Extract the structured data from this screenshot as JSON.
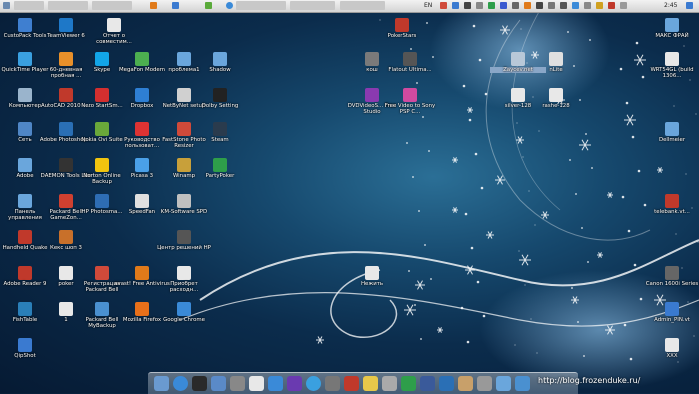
{
  "menubar": {
    "language": "EN",
    "time": "2:45"
  },
  "icons": [
    {
      "label": "CustoPack Tools",
      "icon": "custopack-icon",
      "color": "#3f7fd0"
    },
    {
      "label": "TeamViewer 6",
      "icon": "teamviewer-icon",
      "color": "#1e78c8"
    },
    {
      "label": "Отчет о совместим...",
      "icon": "document-icon",
      "color": "#e8e8e8"
    },
    {
      "label": "QuickTime Player",
      "icon": "quicktime-icon",
      "color": "#3aa0e0"
    },
    {
      "label": "60-дневная пробная ...",
      "icon": "office-icon",
      "color": "#e8902a"
    },
    {
      "label": "Skype",
      "icon": "skype-icon",
      "color": "#12a5e8"
    },
    {
      "label": "MegaFon Modem",
      "icon": "megafon-icon",
      "color": "#4caf50"
    },
    {
      "label": "проблема1",
      "icon": "folder-icon",
      "color": "#6aa6dc"
    },
    {
      "label": "Shadow",
      "icon": "folder-icon",
      "color": "#6aa6dc"
    },
    {
      "label": "Компьютер",
      "icon": "computer-icon",
      "color": "#9ab4cc"
    },
    {
      "label": "AutoCAD 2010 - ...",
      "icon": "autocad-icon",
      "color": "#c0392b"
    },
    {
      "label": "Nero StartSm...",
      "icon": "nero-icon",
      "color": "#d32f2f"
    },
    {
      "label": "Dropbox",
      "icon": "dropbox-icon",
      "color": "#2e7fd4"
    },
    {
      "label": "NetByNet setup",
      "icon": "netbynet-icon",
      "color": "#d0d0d0"
    },
    {
      "label": "Dolby Setting",
      "icon": "dolby-icon",
      "color": "#222222"
    },
    {
      "label": "Сеть",
      "icon": "network-icon",
      "color": "#4f86c6"
    },
    {
      "label": "Adobe Photoshop...",
      "icon": "photoshop-icon",
      "color": "#2a6fb5"
    },
    {
      "label": "Nokia Ovi Suite",
      "icon": "nokia-ovi-icon",
      "color": "#6aa83a"
    },
    {
      "label": "Руководство пользоват...",
      "icon": "help-icon",
      "color": "#d33"
    },
    {
      "label": "FastStone Photo Resizer",
      "icon": "faststone-icon",
      "color": "#d04a3a"
    },
    {
      "label": "Steam",
      "icon": "steam-icon",
      "color": "#2a3b4d"
    },
    {
      "label": "Adobe",
      "icon": "folder-icon",
      "color": "#6aa6dc"
    },
    {
      "label": "DAEMON Tools Lite",
      "icon": "daemon-tools-icon",
      "color": "#333"
    },
    {
      "label": "Norton Online Backup",
      "icon": "norton-icon",
      "color": "#f1c40f"
    },
    {
      "label": "Picasa 3",
      "icon": "picasa-icon",
      "color": "#4aa0e8"
    },
    {
      "label": "Winamp",
      "icon": "winamp-icon",
      "color": "#c8a03a"
    },
    {
      "label": "PartyPoker",
      "icon": "partypoker-icon",
      "color": "#2e9e4a"
    },
    {
      "label": "Панель управления",
      "icon": "control-panel-icon",
      "color": "#6aa6dc"
    },
    {
      "label": "Packard Bell GameZon...",
      "icon": "gamezone-icon",
      "color": "#d04030"
    },
    {
      "label": "HP Photosma...",
      "icon": "hp-icon",
      "color": "#2e6db4"
    },
    {
      "label": "SpeedFan",
      "icon": "speedfan-icon",
      "color": "#e0e0e0"
    },
    {
      "label": "KM-Software SPD",
      "icon": "km-software-icon",
      "color": "#c0c0c0"
    },
    {
      "label": "Handheld Quake",
      "icon": "quake-icon",
      "color": "#c0392b"
    },
    {
      "label": "Кекс шоп 3",
      "icon": "game-icon",
      "color": "#c8702a"
    },
    {
      "label": "Центр решений HP",
      "icon": "hp-center-icon",
      "color": "#555"
    },
    {
      "label": "Adobe Reader 9",
      "icon": "adobe-reader-icon",
      "color": "#c0392b"
    },
    {
      "label": "poker",
      "icon": "document-icon",
      "color": "#e8e8e8"
    },
    {
      "label": "Регистрация Packard Bell",
      "icon": "registration-icon",
      "color": "#d04a3a"
    },
    {
      "label": "avast! Free Antivirus",
      "icon": "avast-icon",
      "color": "#e07a1a"
    },
    {
      "label": "Приобрет расходн...",
      "icon": "document-icon",
      "color": "#e8e8e8"
    },
    {
      "label": "FishTable",
      "icon": "fishtable-icon",
      "color": "#2a7fb8"
    },
    {
      "label": "1",
      "icon": "document-icon",
      "color": "#e8e8e8"
    },
    {
      "label": "Packard Bell MyBackup",
      "icon": "mybackup-icon",
      "color": "#4a90d0"
    },
    {
      "label": "Mozilla Firefox",
      "icon": "firefox-icon",
      "color": "#e8701a"
    },
    {
      "label": "Google Chrome",
      "icon": "chrome-icon",
      "color": "#3a8ad8"
    },
    {
      "label": "QipShot",
      "icon": "qipshot-icon",
      "color": "#3a7ad0"
    },
    {
      "label": "PokerStars",
      "icon": "pokerstars-icon",
      "color": "#c0392b"
    },
    {
      "label": "кош",
      "icon": "folder-icon",
      "color": "#7a7a7a"
    },
    {
      "label": "Flatout Ultima...",
      "icon": "flatout-icon",
      "color": "#555"
    },
    {
      "label": "DVDVideoS... Free Studio",
      "icon": "dvd-studio-icon",
      "color": "#8a3ab0"
    },
    {
      "label": "Free Video to Sony PSP C...",
      "icon": "video-converter-icon",
      "color": "#d04aa0"
    },
    {
      "label": "Нежить",
      "icon": "document-icon",
      "color": "#e8e8e8"
    },
    {
      "label": "Zaycev.net",
      "icon": "zaycev-icon",
      "color": "#b8c8d8"
    },
    {
      "label": "nLite",
      "icon": "nlite-icon",
      "color": "#e0e0e0"
    },
    {
      "label": "silver-128",
      "icon": "image-icon",
      "color": "#e8e8e8"
    },
    {
      "label": "rashe-128",
      "icon": "image-icon",
      "color": "#e8e8e8"
    },
    {
      "label": "МАКС ФРАЙ",
      "icon": "folder-icon",
      "color": "#6aa6dc"
    },
    {
      "label": "WRT54GL (build 1306...",
      "icon": "document-icon",
      "color": "#e8e8e8"
    },
    {
      "label": "Dellmeier",
      "icon": "folder-icon",
      "color": "#6aa6dc"
    },
    {
      "label": "telebank.vt...",
      "icon": "telebank-icon",
      "color": "#c0392b"
    },
    {
      "label": "Canon 1600i Series",
      "icon": "canon-icon",
      "color": "#666"
    },
    {
      "label": "Admin_PIN.vt",
      "icon": "admin-pin-icon",
      "color": "#3a7ad0"
    },
    {
      "label": "XXX",
      "icon": "document-icon",
      "color": "#e8e8e8"
    }
  ],
  "dock": [
    "finder-icon",
    "chrome-icon",
    "monitor-icon",
    "mail-icon",
    "calculator-icon",
    "textedit-icon",
    "appstore-icon",
    "itunes-icon",
    "quicktime-icon",
    "tools-icon",
    "pokerstars-icon",
    "notes-icon",
    "settings-icon",
    "utorrent-icon",
    "lightroom-icon",
    "photoshop-icon",
    "archive-icon",
    "trash-icon",
    "folder-icon",
    "web-icon"
  ],
  "watermark": "http://blog.frozenduke.ru/"
}
